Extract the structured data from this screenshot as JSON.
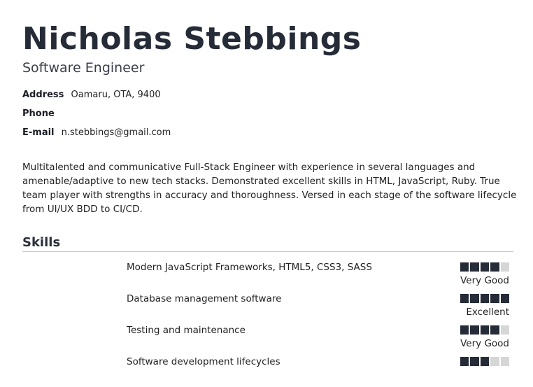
{
  "resume": {
    "name": "Nicholas Stebbings",
    "title": "Software Engineer",
    "contact": {
      "address_label": "Address",
      "address_value": "Oamaru, OTA, 9400",
      "phone_label": "Phone",
      "phone_value": "",
      "email_label": "E-mail",
      "email_value": "n.stebbings@gmail.com"
    },
    "summary": "Multitalented and communicative Full-Stack Engineer with experience in several languages and amenable/adaptive to new tech stacks. Demonstrated excellent skills in HTML, JavaScript, Ruby. True team player with strengths in accuracy and thoroughness. Versed in each stage of the software lifecycle from UI/UX BDD to CI/CD.",
    "skills_heading": "Skills",
    "skills": [
      {
        "name": "Modern JavaScript Frameworks, HTML5, CSS3, SASS",
        "level": "Very Good",
        "rating": 4,
        "max": 5
      },
      {
        "name": "Database management software",
        "level": "Excellent",
        "rating": 5,
        "max": 5
      },
      {
        "name": "Testing and maintenance",
        "level": "Very Good",
        "rating": 4,
        "max": 5
      },
      {
        "name": "Software development lifecycles",
        "level": "",
        "rating": 3,
        "max": 5
      }
    ]
  },
  "colors": {
    "heading": "#262b38",
    "rating_on": "#262b38",
    "rating_off": "#d6d6d6",
    "rule": "#c8c8c8"
  }
}
